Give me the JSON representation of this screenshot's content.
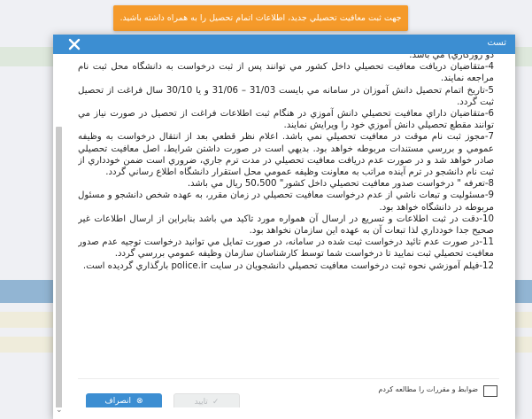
{
  "toast": {
    "text": "جهت ثبت معافيت تحصيلي جديد، اطلاعات اتمام تحصيل را به همراه داشته باشيد."
  },
  "modal": {
    "title": "تست",
    "close_icon": "×",
    "paragraphs": [
      "دو روزکاري) مي باشد.",
      "4-متقاضيان دريافت معافيت تحصيلي داخل کشور مي توانند پس از ثبت درخواست به دانشگاه محل ثبت نام مراجعه نمايند.",
      "5-تاريخ اتمام تحصيل دانش آموزان در سامانه مي بايست 31/03 – 31/06 و يا 30/10 سال فراغت از تحصيل ثبت گردد.",
      "6-متقاضيان داراي معافيت تحصيلي دانش آموزي در هنگام ثبت اطلاعات فراغت از تحصيل در صورت نياز مي توانند مقطع تحصيلي دانش آموزي خود را ويرايش نمايند.",
      "7-مجوز ثبت نام موقت در معافيت تحصيلي نمي باشد. اعلام نظر قطعي بعد از انتقال درخواست به وظيفه عمومي و بررسي مستندات مربوطه خواهد بود. بديهي است در صورت داشتن شرايط، اصل معافيت تحصيلي صادر خواهد شد و در صورت عدم دريافت معافيت تحصيلي در مدت ترم جاري، ضروري است ضمن خودداري از ثبت نام دانشجو در ترم آينده مراتب به معاونت وظيفه عمومي محل استقرار دانشگاه اطلاع رساني گردد.",
      "8-تعرفه \" درخواست صدور معافيت تحصيلي داخل کشور\" 50،500 ريال مي باشد.",
      "9-مسئوليت و تبعات ناشي از عدم درخواست معافيت تحصيلي در زمان مقرر، به عهده شخص دانشجو و مسئول مربوطه در دانشگاه خواهد بود.",
      "10-دقت در ثبت اطلاعات و تسريع در ارسال آن همواره مورد تاکيد مي باشد بنابراين از ارسال اطلاعات غير صحيح جدا خودداري لذا تبعات آن به عهده اين سازمان نخواهد بود.",
      "11-در صورت عدم تائيد درخواست ثبت شده در سامانه، در صورت تمايل مي توانيد درخواست توجيه عدم صدور معافيت تحصيلي ثبت نماييد تا درخواست شما توسط کارشناسان سازمان وظيفه عمومي بررسي گردد.",
      "12-فيلم آموزشي نحوه ثبت درخواست معافيت تحصيلي دانشجويان در سايت police.ir بارگذاري گرديده است."
    ],
    "agree_label": "ضوابط و مقررات را مطالعه کردم",
    "cancel_label": "انصراف",
    "cancel_icon": "⊗",
    "confirm_label": "تاييد",
    "confirm_icon": "✓"
  }
}
